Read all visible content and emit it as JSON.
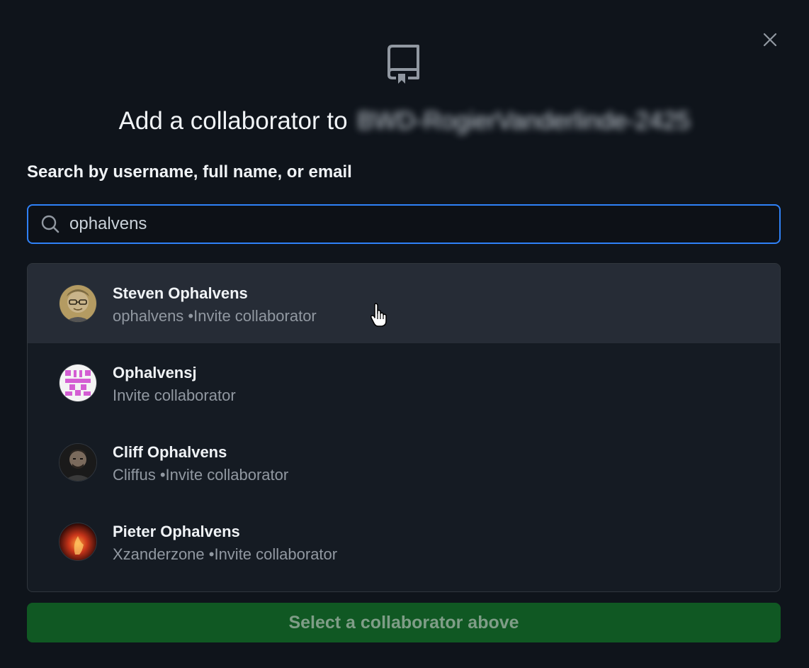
{
  "dialog": {
    "title_prefix": "Add a collaborator to",
    "repo_name": "BWD-RogierVanderlinde-2425",
    "close_icon": "x-icon",
    "repo_icon": "repo-icon"
  },
  "search": {
    "label": "Search by username, full name, or email",
    "value": "ophalvens",
    "icon": "search-icon",
    "accent_color": "#2f81f7"
  },
  "results": [
    {
      "name": "Steven Ophalvens",
      "username": "ophalvens",
      "action": "Invite collaborator",
      "sub": "ophalvens •Invite collaborator",
      "highlighted": true,
      "avatar": "photo-avatar-glasses"
    },
    {
      "name": "Ophalvensj",
      "username": "",
      "action": "Invite collaborator",
      "sub": "Invite collaborator",
      "highlighted": false,
      "avatar": "identicon-pink"
    },
    {
      "name": "Cliff Ophalvens",
      "username": "Cliffus",
      "action": "Invite collaborator",
      "sub": "Cliffus •Invite collaborator",
      "highlighted": false,
      "avatar": "photo-avatar-dark"
    },
    {
      "name": "Pieter Ophalvens",
      "username": "Xzanderzone",
      "action": "Invite collaborator",
      "sub": "Xzanderzone •Invite collaborator",
      "highlighted": false,
      "avatar": "photo-avatar-red"
    }
  ],
  "submit": {
    "label": "Select a collaborator above",
    "disabled": true,
    "color": "#105823"
  }
}
